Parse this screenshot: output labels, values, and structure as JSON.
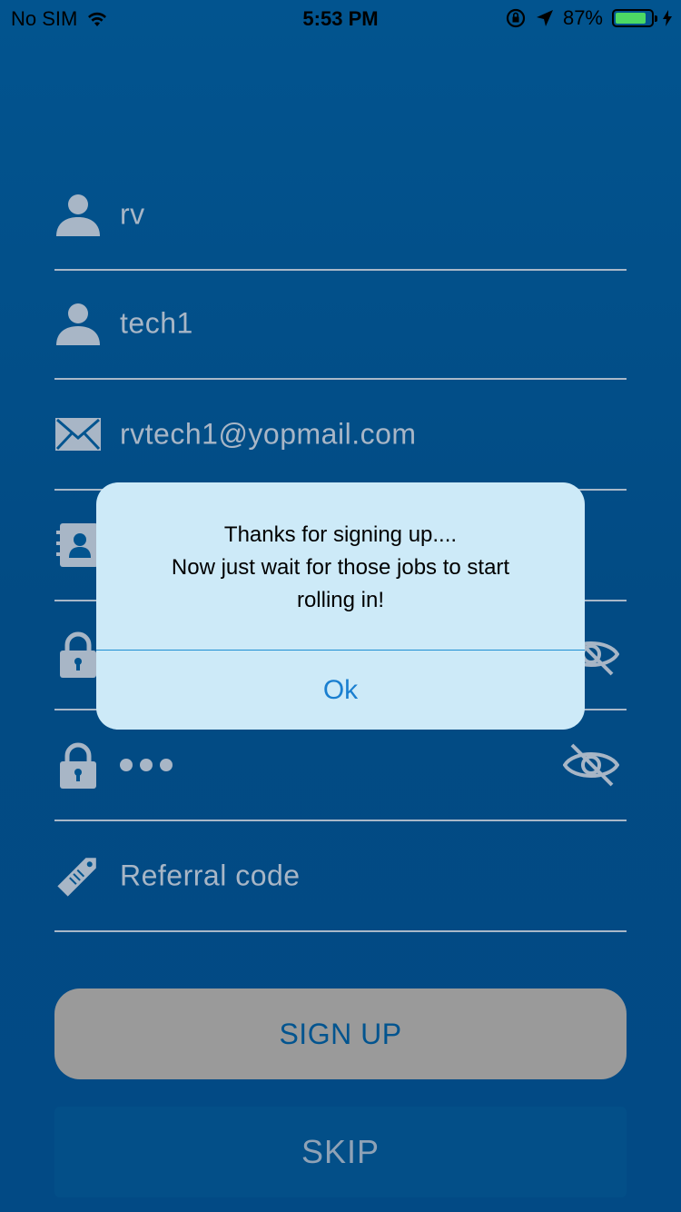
{
  "status_bar": {
    "carrier": "No SIM",
    "time": "5:53 PM",
    "battery_percent": "87%",
    "battery_level": 0.87
  },
  "form": {
    "first_name": "rv",
    "last_name": "tech1",
    "email": "rvtech1@yopmail.com",
    "referral_placeholder": "Referral code"
  },
  "buttons": {
    "signup": "SIGN UP",
    "skip": "SKIP"
  },
  "alert": {
    "line1": "Thanks for signing up....",
    "line2": "Now just wait for those jobs to start",
    "line3": "rolling in!",
    "ok": "Ok"
  },
  "colors": {
    "background": "#02548f",
    "field_text": "#a8b6c6",
    "alert_bg": "#cdeaf8",
    "alert_button": "#1a7fd0"
  }
}
